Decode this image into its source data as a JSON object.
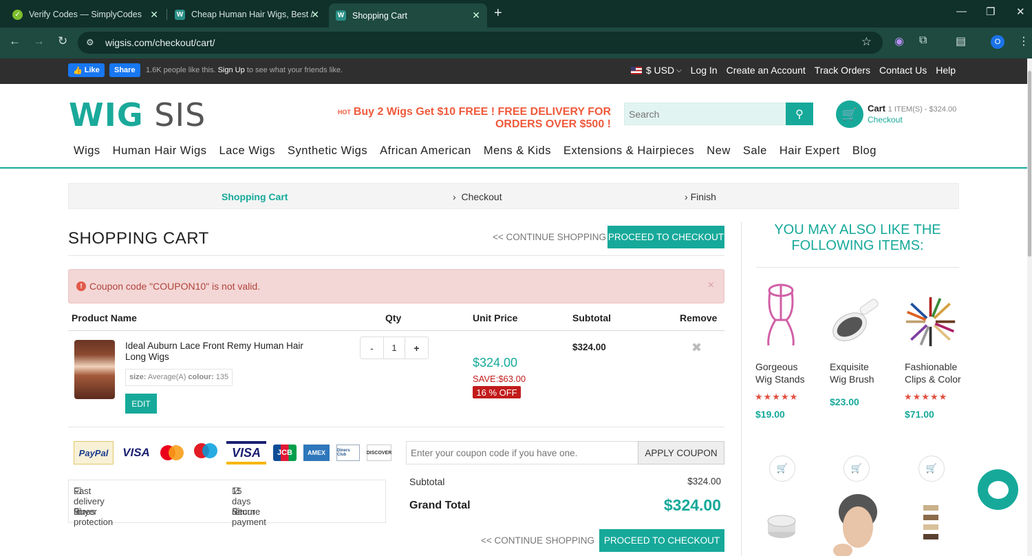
{
  "browser": {
    "tabs": [
      {
        "title": "Verify Codes — SimplyCodes"
      },
      {
        "title": "Cheap Human Hair Wigs, Best /"
      },
      {
        "title": "Shopping Cart"
      }
    ],
    "url": "wigsis.com/checkout/cart/",
    "profile_initial": "O"
  },
  "topbar": {
    "like": "Like",
    "share": "Share",
    "social_text": "1.6K people like this.",
    "signup": "Sign Up",
    "social_tail": "to see what your friends like.",
    "currency": "$ USD",
    "links": [
      "Log In",
      "Create an Account",
      "Track Orders",
      "Contact Us",
      "Help"
    ]
  },
  "header": {
    "logo_a": "WIG",
    "logo_b": "SIS",
    "promo_badge": "HOT",
    "promo": "Buy 2 Wigs Get $10 FREE ! FREE DELIVERY FOR ORDERS OVER $500 !",
    "search_placeholder": "Search",
    "cart_label": "Cart",
    "cart_count": "1 ITEM(S) - $324.00",
    "cart_checkout": "Checkout"
  },
  "nav": [
    "Wigs",
    "Human Hair Wigs",
    "Lace Wigs",
    "Synthetic Wigs",
    "African American",
    "Mens & Kids",
    "Extensions & Hairpieces",
    "New",
    "Sale",
    "Hair Expert",
    "Blog"
  ],
  "steps": [
    "Shopping Cart",
    "Checkout",
    "Finish"
  ],
  "cart": {
    "title": "SHOPPING CART",
    "continue": "<< CONTINUE SHOPPING",
    "proceed": "PROCEED TO CHECKOUT",
    "alert": "Coupon code \"COUPON10\" is not valid.",
    "alert_close": "×",
    "columns": [
      "Product Name",
      "Qty",
      "Unit Price",
      "Subtotal",
      "Remove"
    ],
    "item": {
      "name": "Ideal Auburn Lace Front Remy Human Hair Long Wigs",
      "size_label": "size:",
      "size": "Average(A)",
      "colour_label": "colour:",
      "colour": "135",
      "edit": "EDIT",
      "qty_minus": "-",
      "qty": "1",
      "qty_plus": "+",
      "price": "$324.00",
      "save": "SAVE:$63.00",
      "off": "16 % OFF",
      "subtotal": "$324.00",
      "remove": "✖"
    },
    "payments": [
      "PayPal",
      "VISA",
      "mastercard",
      "maestro",
      "VISA",
      "JCB",
      "AMEX",
      "Diners Club",
      "DISCOVER"
    ],
    "features": [
      "Fast delivery times",
      "15 days return",
      "Buyer protection",
      "Secure payment"
    ],
    "coupon_placeholder": "Enter your coupon code if you have one.",
    "apply": "APPLY COUPON",
    "subtotal_label": "Subtotal",
    "subtotal": "$324.00",
    "grand_label": "Grand Total",
    "grand": "$324.00"
  },
  "also": {
    "title": "YOU MAY ALSO LIKE THE FOLLOWING ITEMS:",
    "items": [
      {
        "name1": "Gorgeous",
        "name2": "Wig Stands",
        "stars": "★★★★★",
        "price": "$19.00"
      },
      {
        "name1": "Exquisite",
        "name2": "Wig Brush",
        "stars": "",
        "price": "$23.00"
      },
      {
        "name1": "Fashionable",
        "name2": "Clips & Color",
        "stars": "★★★★★",
        "price": "$71.00"
      }
    ]
  },
  "colors": {
    "accent": "#16a99a",
    "promo": "#ef5a3c",
    "sale": "#c21b1b"
  }
}
